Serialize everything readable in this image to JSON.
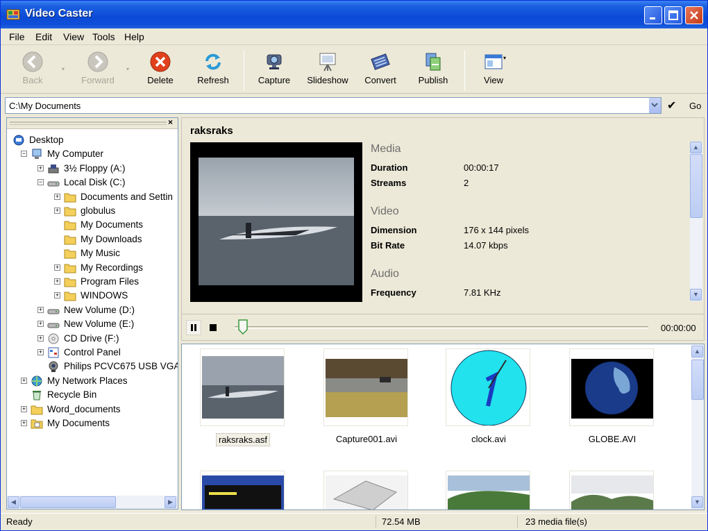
{
  "window": {
    "title": "Video Caster"
  },
  "menu": [
    {
      "label": "File",
      "key": "F"
    },
    {
      "label": "Edit",
      "key": "E"
    },
    {
      "label": "View",
      "key": "V"
    },
    {
      "label": "Tools",
      "key": "T"
    },
    {
      "label": "Help",
      "key": "H"
    }
  ],
  "toolbar": {
    "back": "Back",
    "forward": "Forward",
    "delete": "Delete",
    "refresh": "Refresh",
    "capture": "Capture",
    "slideshow": "Slideshow",
    "convert": "Convert",
    "publish": "Publish",
    "view": "View"
  },
  "address": {
    "value": "C:\\My Documents",
    "go": "Go"
  },
  "tree": [
    {
      "label": "Desktop",
      "level": 0,
      "exp": "",
      "icon": "desktop-icon"
    },
    {
      "label": "My Computer",
      "level": 1,
      "exp": "-",
      "icon": "computer-icon"
    },
    {
      "label": "3½ Floppy (A:)",
      "level": 2,
      "exp": "+",
      "icon": "floppy-drive-icon"
    },
    {
      "label": "Local Disk (C:)",
      "level": 2,
      "exp": "-",
      "icon": "hard-drive-icon"
    },
    {
      "label": "Documents and Settin",
      "level": 3,
      "exp": "+",
      "icon": "folder-icon"
    },
    {
      "label": "globulus",
      "level": 3,
      "exp": "+",
      "icon": "folder-icon"
    },
    {
      "label": "My Documents",
      "level": 3,
      "exp": "",
      "icon": "folder-icon"
    },
    {
      "label": "My Downloads",
      "level": 3,
      "exp": "",
      "icon": "folder-icon"
    },
    {
      "label": "My Music",
      "level": 3,
      "exp": "",
      "icon": "folder-icon"
    },
    {
      "label": "My Recordings",
      "level": 3,
      "exp": "+",
      "icon": "folder-icon"
    },
    {
      "label": "Program Files",
      "level": 3,
      "exp": "+",
      "icon": "folder-icon"
    },
    {
      "label": "WINDOWS",
      "level": 3,
      "exp": "+",
      "icon": "folder-icon"
    },
    {
      "label": "New Volume (D:)",
      "level": 2,
      "exp": "+",
      "icon": "hard-drive-icon"
    },
    {
      "label": "New Volume (E:)",
      "level": 2,
      "exp": "+",
      "icon": "hard-drive-icon"
    },
    {
      "label": "CD Drive (F:)",
      "level": 2,
      "exp": "+",
      "icon": "cd-drive-icon"
    },
    {
      "label": "Control Panel",
      "level": 2,
      "exp": "+",
      "icon": "control-panel-icon"
    },
    {
      "label": "Philips PCVC675 USB VGA",
      "level": 2,
      "exp": "",
      "icon": "webcam-icon"
    },
    {
      "label": "My Network Places",
      "level": 1,
      "exp": "+",
      "icon": "network-icon"
    },
    {
      "label": "Recycle Bin",
      "level": 1,
      "exp": "",
      "icon": "recycle-bin-icon"
    },
    {
      "label": "Word_documents",
      "level": 1,
      "exp": "+",
      "icon": "folder-icon"
    },
    {
      "label": "My Documents",
      "level": 1,
      "exp": "+",
      "icon": "my-documents-icon"
    }
  ],
  "preview": {
    "name": "raksraks",
    "media_heading": "Media",
    "duration_label": "Duration",
    "duration": "00:00:17",
    "streams_label": "Streams",
    "streams": "2",
    "video_heading": "Video",
    "dimension_label": "Dimension",
    "dimension": "176 x 144 pixels",
    "bitrate_label": "Bit Rate",
    "bitrate": "14.07 kbps",
    "audio_heading": "Audio",
    "frequency_label": "Frequency",
    "frequency": "7.81 KHz",
    "time": "00:00:00",
    "position": 0.02
  },
  "thumbnails": [
    {
      "name": "raksraks.asf",
      "selected": true
    },
    {
      "name": "Capture001.avi",
      "selected": false
    },
    {
      "name": "clock.avi",
      "selected": false
    },
    {
      "name": "GLOBE.AVI",
      "selected": false
    }
  ],
  "status": {
    "left": "Ready",
    "size": "72.54 MB",
    "count": "23 media file(s)"
  }
}
